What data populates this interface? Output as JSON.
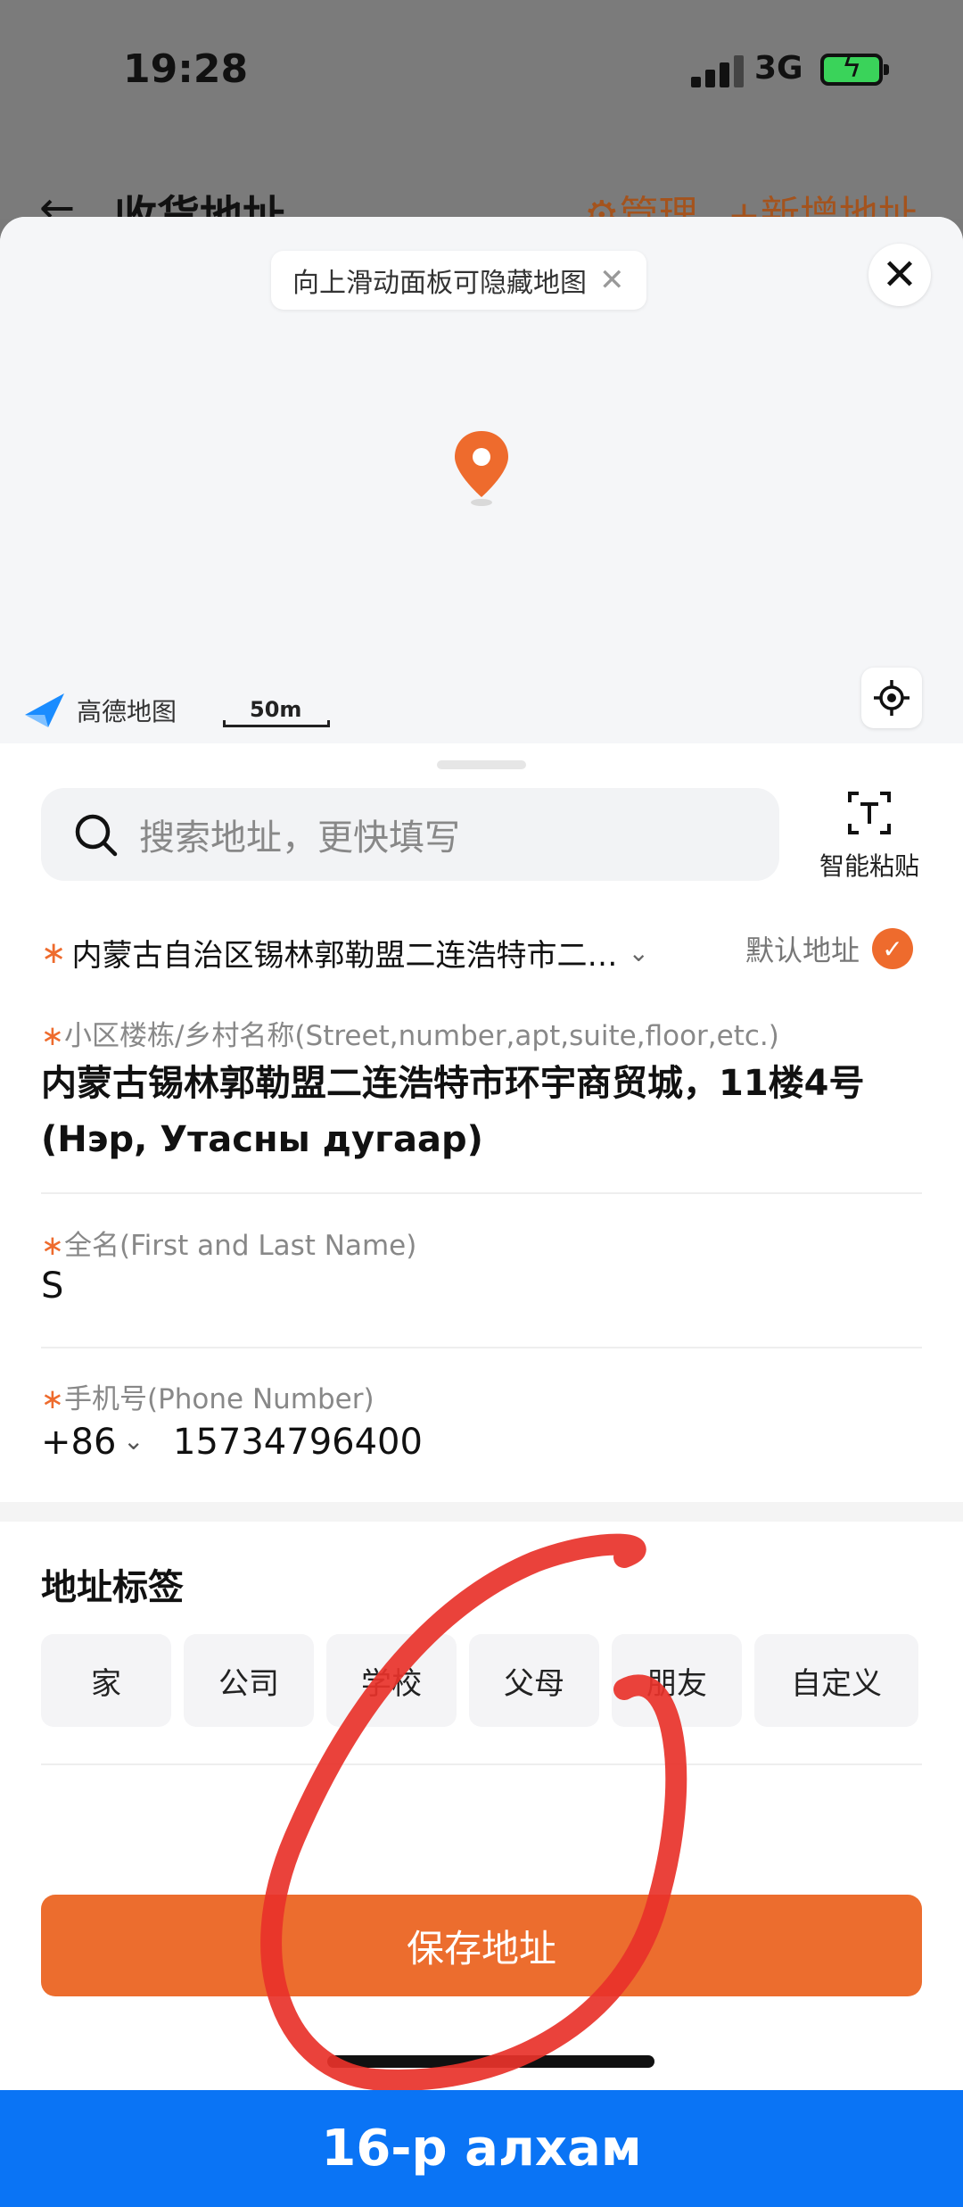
{
  "status_bar": {
    "time": "19:28",
    "network": "3G"
  },
  "behind_header": {
    "back_icon": "arrow-left-icon",
    "title": "收货地址",
    "manage": "⚙管理",
    "add": "+新增地址"
  },
  "map": {
    "hint": "向上滑动面板可隐藏地图",
    "hint_close": "✕",
    "close": "✕",
    "brand": "高德地图",
    "scale": "50m",
    "pin_color": "#ee6b2d"
  },
  "search": {
    "placeholder": "搜索地址，更快填写",
    "paste_label": "智能粘贴"
  },
  "region": {
    "value": "内蒙古自治区锡林郭勒盟二连浩特市二…",
    "chevron": "⌄"
  },
  "default_address": {
    "label": "默认地址",
    "checked": true
  },
  "street": {
    "label": "小区楼栋/乡村名称(Street,number,apt,suite,floor,etc.)",
    "value": "内蒙古锡林郭勒盟二连浩特市环宇商贸城，11楼4号(Нэр, Утасны дугаар)"
  },
  "name": {
    "label": "全名(First and Last Name)",
    "value": "S"
  },
  "phone": {
    "label": "手机号(Phone Number)",
    "code": "+86",
    "chevron": "⌄",
    "value": "15734796400"
  },
  "required_mark": "∗",
  "tags": {
    "title": "地址标签",
    "items": [
      "家",
      "公司",
      "学校",
      "父母",
      "朋友",
      "自定义"
    ]
  },
  "save_button": "保存地址",
  "footer": "16-р алхам",
  "colors": {
    "accent": "#ec6d2e",
    "footer_bg": "#0a74f5",
    "annotation": "#e8322a"
  }
}
